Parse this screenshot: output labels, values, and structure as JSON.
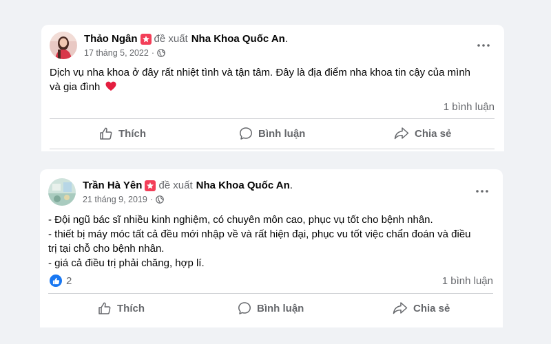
{
  "posts": [
    {
      "author": "Thảo Ngân",
      "verb": "đề xuất",
      "page": "Nha Khoa Quốc An",
      "date": "17 tháng 5, 2022",
      "separator": "·",
      "text_lines": [
        "Dịch vụ nha khoa ở đây rất nhiệt tình và tận tâm. Đây là địa điểm nha khoa tin cậy của mình",
        "và gia đình"
      ],
      "emoji": "❤️",
      "comments": "1 bình luận",
      "actions": {
        "like": "Thích",
        "comment": "Bình luận",
        "share": "Chia sẻ"
      }
    },
    {
      "author": "Trần Hà Yên",
      "verb": "đề xuất",
      "page": "Nha Khoa Quốc An",
      "date": "21 tháng 9, 2019",
      "separator": "·",
      "text_lines": [
        "- Đội ngũ bác sĩ nhiều kinh nghiệm, có chuyên môn cao, phục vụ tốt cho bệnh nhân.",
        "- thiết bị máy móc tất cả đều mới nhập về và rất hiện đại, phục vu tốt việc chẩn đoán và điều",
        "trị tại chỗ cho bệnh nhân.",
        "- giá cả điều trị phải chăng, hợp lí."
      ],
      "reactions_count": "2",
      "comments": "1 bình luận",
      "actions": {
        "like": "Thích",
        "comment": "Bình luận",
        "share": "Chia sẻ"
      }
    }
  ],
  "colors": {
    "background": "#f0f2f5",
    "card": "#ffffff",
    "secondary_text": "#65676b",
    "recommend_badge": "#f33e58",
    "like_blue": "#1877f2",
    "heart_red": "#e41e3f"
  }
}
